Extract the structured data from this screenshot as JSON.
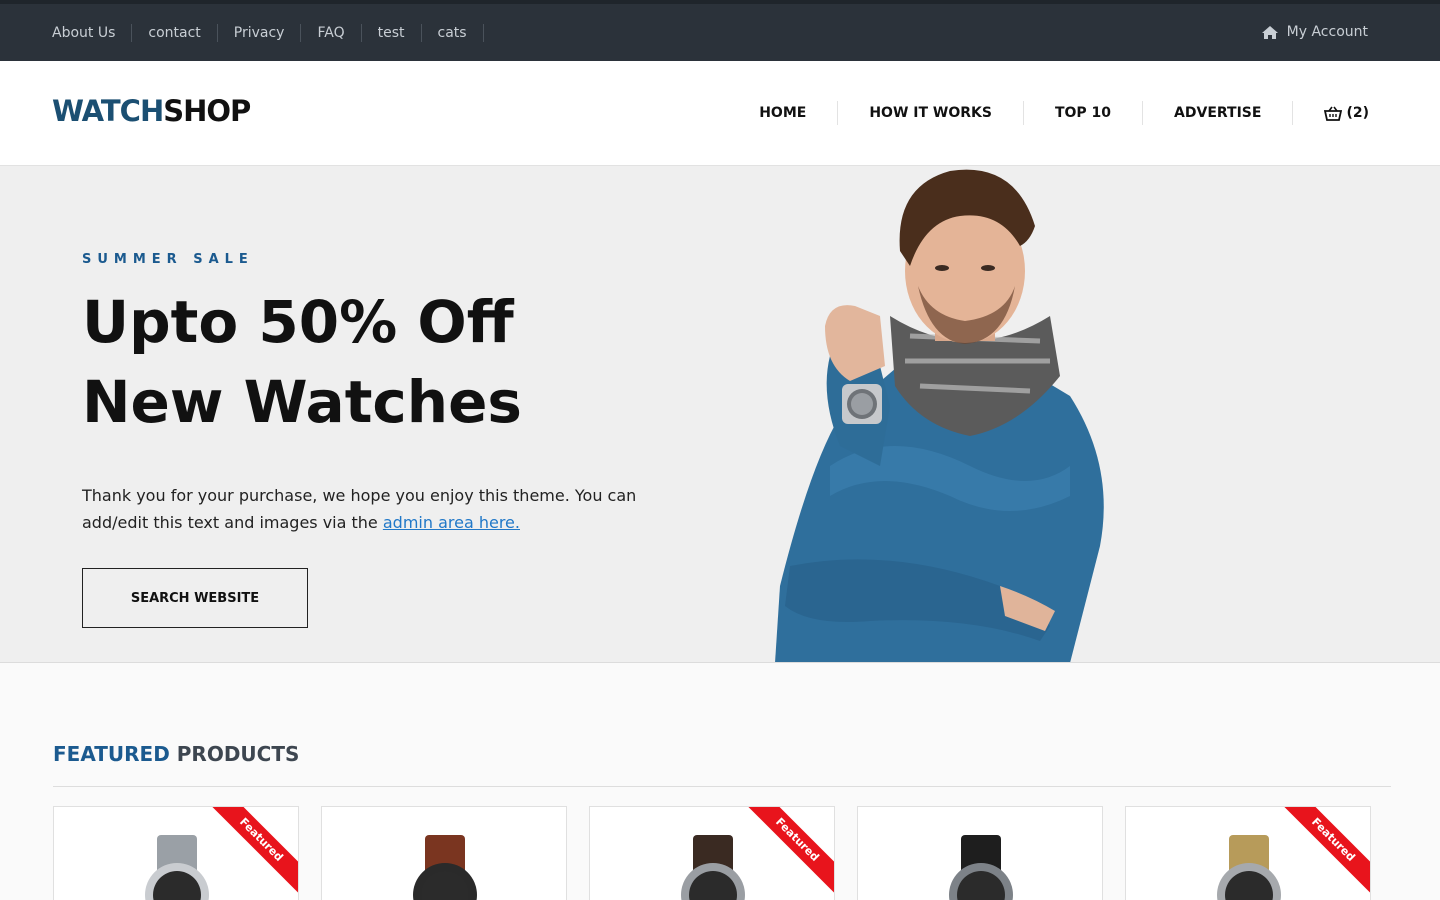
{
  "topbar": {
    "links": [
      "About Us",
      "contact",
      "Privacy",
      "FAQ",
      "test",
      "cats"
    ],
    "account_label": "My Account",
    "account_icon": "home-icon"
  },
  "header": {
    "logo_part1": "WATCH",
    "logo_part2": "SHOP",
    "nav": [
      "HOME",
      "HOW IT WORKS",
      "TOP 10",
      "ADVERTISE"
    ],
    "cart_label": "(2)",
    "cart_icon": "basket-icon"
  },
  "hero": {
    "eyebrow": "SUMMER SALE",
    "headline_line1": "Upto 50% Off",
    "headline_line2": "New Watches",
    "blurb_text": "Thank you for your purchase, we hope you enjoy this theme. You can add/edit this text and images via the ",
    "blurb_link": "admin area here.",
    "cta_label": "SEARCH WEBSITE"
  },
  "featured": {
    "title_part1": "FEATURED",
    "title_part2": "PRODUCTS",
    "products": [
      {
        "featured": true,
        "ribbon": "Featured",
        "band_color": "#9aa0a6",
        "case_color": "#c9ccd0"
      },
      {
        "featured": false,
        "ribbon": "",
        "band_color": "#7a3520",
        "case_color": "#2a2a2a"
      },
      {
        "featured": true,
        "ribbon": "Featured",
        "band_color": "#3a2a22",
        "case_color": "#9a9ea3"
      },
      {
        "featured": false,
        "ribbon": "",
        "band_color": "#1e1e1e",
        "case_color": "#7d8288"
      },
      {
        "featured": true,
        "ribbon": "Featured",
        "band_color": "#b79b5a",
        "case_color": "#a6a9ad"
      }
    ]
  },
  "colors": {
    "accent": "#1b5a8f",
    "ribbon": "#e8141c",
    "topbar": "#2b323a"
  }
}
